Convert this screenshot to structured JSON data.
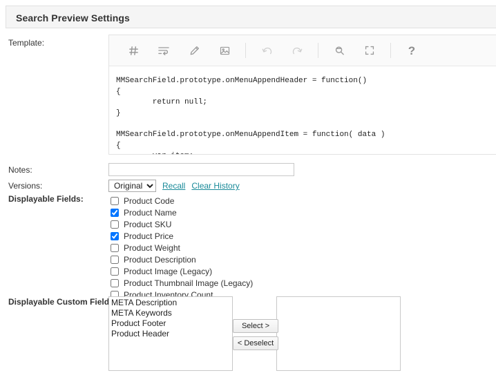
{
  "panel": {
    "title": "Search Preview Settings"
  },
  "labels": {
    "template": "Template:",
    "notes": "Notes:",
    "versions": "Versions:",
    "displayable_fields": "Displayable Fields:",
    "displayable_custom_fields": "Displayable Custom Fields:"
  },
  "editor": {
    "toolbar": [
      {
        "icon": "hash-icon",
        "name": "toggle-line-numbers-button",
        "dim": false
      },
      {
        "icon": "wrap-lines-icon",
        "name": "toggle-wrap-lines-button",
        "dim": false
      },
      {
        "icon": "pencil-icon",
        "name": "edit-button",
        "dim": false
      },
      {
        "icon": "image-icon",
        "name": "insert-image-button",
        "dim": false
      },
      {
        "icon": "undo-icon",
        "name": "undo-button",
        "dim": true
      },
      {
        "icon": "redo-icon",
        "name": "redo-button",
        "dim": true
      },
      {
        "icon": "search-icon",
        "name": "search-button",
        "dim": false
      },
      {
        "icon": "fullscreen-icon",
        "name": "fullscreen-button",
        "dim": false
      },
      {
        "icon": "help-icon",
        "name": "help-button",
        "dim": false
      }
    ],
    "code": "MMSearchField.prototype.onMenuAppendHeader = function()\n{\n        return null;\n}\n\nMMSearchField.prototype.onMenuAppendItem = function( data )\n{\n        var item;"
  },
  "notes": {
    "value": "",
    "placeholder": ""
  },
  "versions": {
    "selected": "Original",
    "options": [
      "Original"
    ],
    "recall_label": "Recall",
    "clear_history_label": "Clear History"
  },
  "displayable_fields": [
    {
      "label": "Product Code",
      "checked": false
    },
    {
      "label": "Product Name",
      "checked": true
    },
    {
      "label": "Product SKU",
      "checked": false
    },
    {
      "label": "Product Price",
      "checked": true
    },
    {
      "label": "Product Weight",
      "checked": false
    },
    {
      "label": "Product Description",
      "checked": false
    },
    {
      "label": "Product Image (Legacy)",
      "checked": false
    },
    {
      "label": "Product Thumbnail Image (Legacy)",
      "checked": false
    },
    {
      "label": "Product Inventory Count",
      "checked": false
    }
  ],
  "custom_fields": {
    "available": [
      "META Description",
      "META Keywords",
      "Product Footer",
      "Product Header"
    ],
    "selected": [],
    "select_button": "Select >",
    "deselect_button": "< Deselect"
  },
  "colors": {
    "link": "#1a8a99",
    "header_bg": "#f5f5f5",
    "toolbar_icon": "#9a9a9a",
    "toolbar_icon_dim": "#cfcfcf"
  }
}
